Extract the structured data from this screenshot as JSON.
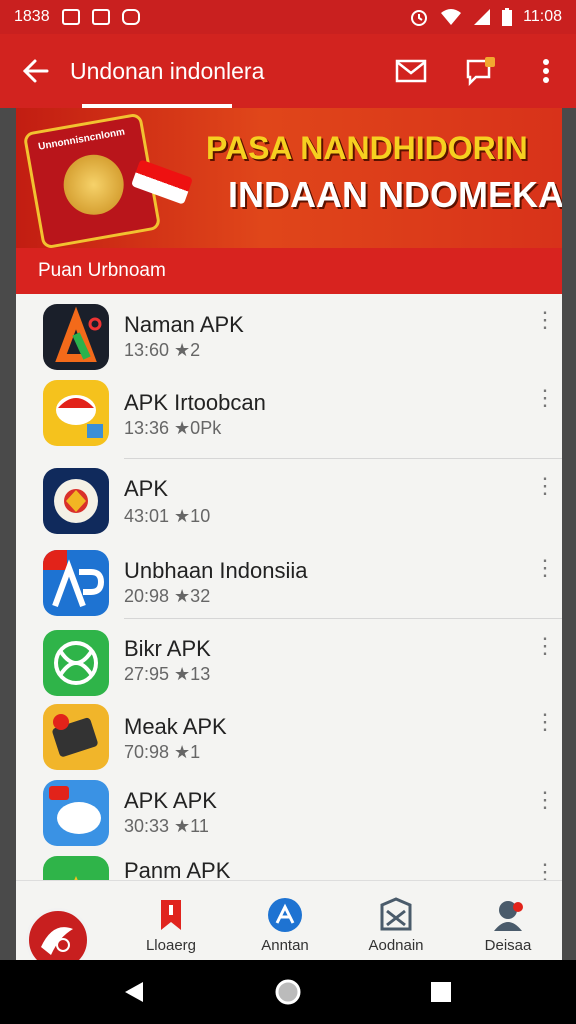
{
  "status_bar": {
    "left_text": "1838",
    "time": "11:08",
    "icons": [
      "image-icon",
      "photo-icon",
      "app-icon",
      "alarm-icon",
      "wifi-icon",
      "signal-icon",
      "battery-icon"
    ]
  },
  "toolbar": {
    "back_icon": "arrow-left-icon",
    "title": "Undonan indonlera",
    "actions": [
      "mail-icon",
      "message-icon",
      "more-vert-icon"
    ]
  },
  "banner": {
    "line1": "PASA NANDHIDORIN",
    "line2": "INDAAN NDOMEKA",
    "card_label": "Unnonnisncnlonm"
  },
  "section_title": "Puan Urbnoam",
  "apps": [
    {
      "name": "Naman APK",
      "meta": "13:60 ★2",
      "icon": "letter-a-icon"
    },
    {
      "name": "APK Irtoobcan",
      "meta": "13:36 ★0Pk",
      "icon": "flag-bird-icon"
    },
    {
      "name": "APK",
      "meta": "43:01 ★10",
      "icon": "garuda-icon"
    },
    {
      "name": "Unbhaan Indonsiia",
      "meta": "20:98 ★32",
      "icon": "ap-icon"
    },
    {
      "name": "Bikr APK",
      "meta": "27:95 ★13",
      "icon": "green-knot-icon"
    },
    {
      "name": "Meak APK",
      "meta": "70:98 ★1",
      "icon": "device-icon"
    },
    {
      "name": "APK APK",
      "meta": "30:33 ★11",
      "icon": "cloud-bird-icon"
    },
    {
      "name": "Panm APK",
      "meta": "",
      "icon": "letter-a-green-icon"
    }
  ],
  "bottom_nav": [
    {
      "label": "Lloaerg",
      "icon": "bookmark-icon"
    },
    {
      "label": "Anntan",
      "icon": "search-icon"
    },
    {
      "label": "Aodnain",
      "icon": "map-icon"
    },
    {
      "label": "Deisaa",
      "icon": "person-icon"
    }
  ],
  "colors": {
    "primary": "#d2231f",
    "status_bar": "#c9201f",
    "sheet_bg": "#f4f4f2",
    "banner_yellow": "#f6d020"
  }
}
